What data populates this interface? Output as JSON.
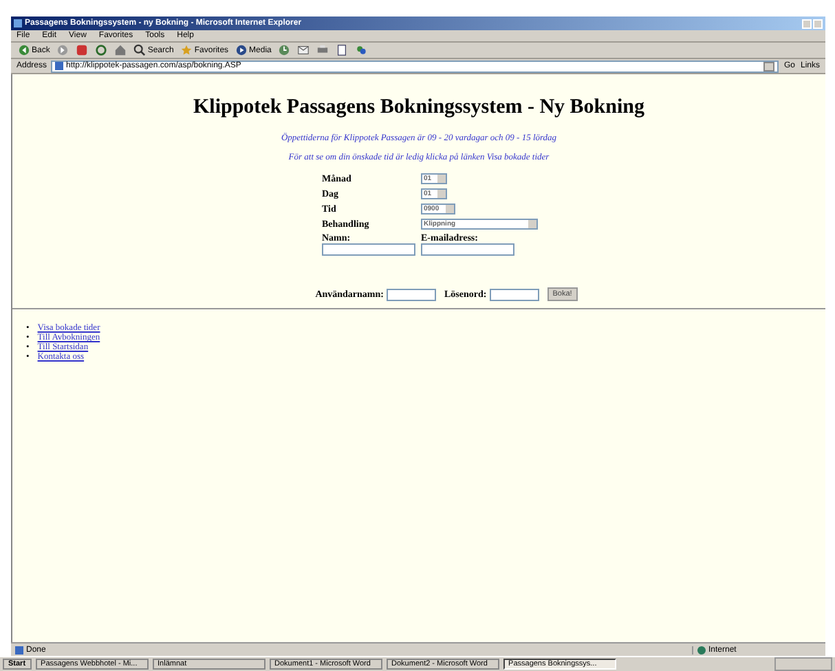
{
  "window": {
    "title": "Passagens Bokningssystem - ny Bokning - Microsoft Internet Explorer"
  },
  "menu": [
    "File",
    "Edit",
    "View",
    "Favorites",
    "Tools",
    "Help"
  ],
  "toolbar": [
    {
      "kind": "back",
      "label": "Back"
    },
    {
      "kind": "forward"
    },
    {
      "kind": "stop"
    },
    {
      "kind": "refresh"
    },
    {
      "kind": "home"
    },
    {
      "kind": "search",
      "label": "Search"
    },
    {
      "kind": "favorites",
      "label": "Favorites"
    },
    {
      "kind": "media",
      "label": "Media"
    },
    {
      "kind": "history"
    },
    {
      "kind": "mail"
    },
    {
      "kind": "print"
    },
    {
      "kind": "edit"
    },
    {
      "kind": "messenger"
    }
  ],
  "address": {
    "label": "Address",
    "value": "http://klippotek-passagen.com/asp/bokning.ASP",
    "go": "Go",
    "links": "Links"
  },
  "page": {
    "heading": "Klippotek Passagens Bokningssystem - Ny Bokning",
    "notes": [
      "Öppettiderna för Klippotek Passagen är 09 - 20 vardagar och 09 - 15 lördag",
      "För att se om din önskade tid är ledig klicka på länken Visa bokade tider"
    ],
    "fields": [
      {
        "label": "Månad",
        "value": "01",
        "kind": "short"
      },
      {
        "label": "Dag",
        "value": "01",
        "kind": "short"
      },
      {
        "label": "Tid",
        "value": "0900",
        "kind": "medium"
      },
      {
        "label": "Behandling",
        "value": "Klippning",
        "kind": "long"
      }
    ],
    "name_label": "Namn:",
    "email_label": "E-mailadress:",
    "username_label": "Användarnamn:",
    "password_label": "Lösenord:",
    "submit": "Boka!",
    "links": [
      {
        "bullet": "•",
        "label": "Visa bokade tider"
      },
      {
        "bullet": "•",
        "label": "Till Avbokningen"
      },
      {
        "bullet": "•",
        "label": "Till Startsidan"
      },
      {
        "bullet": "•",
        "label": "Kontakta oss"
      }
    ]
  },
  "status_bar": {
    "text": "Done",
    "zone": "Internet"
  },
  "taskbar": {
    "start": "Start",
    "items": [
      {
        "label": "Passagens Webbhotel - Mi...",
        "selected": false
      },
      {
        "label": "Inlämnat",
        "selected": false
      },
      {
        "label": "Dokument1 - Microsoft Word",
        "selected": false
      },
      {
        "label": "Dokument2 - Microsoft Word",
        "selected": false
      },
      {
        "label": "Passagens Bokningssys...",
        "selected": true
      }
    ]
  }
}
